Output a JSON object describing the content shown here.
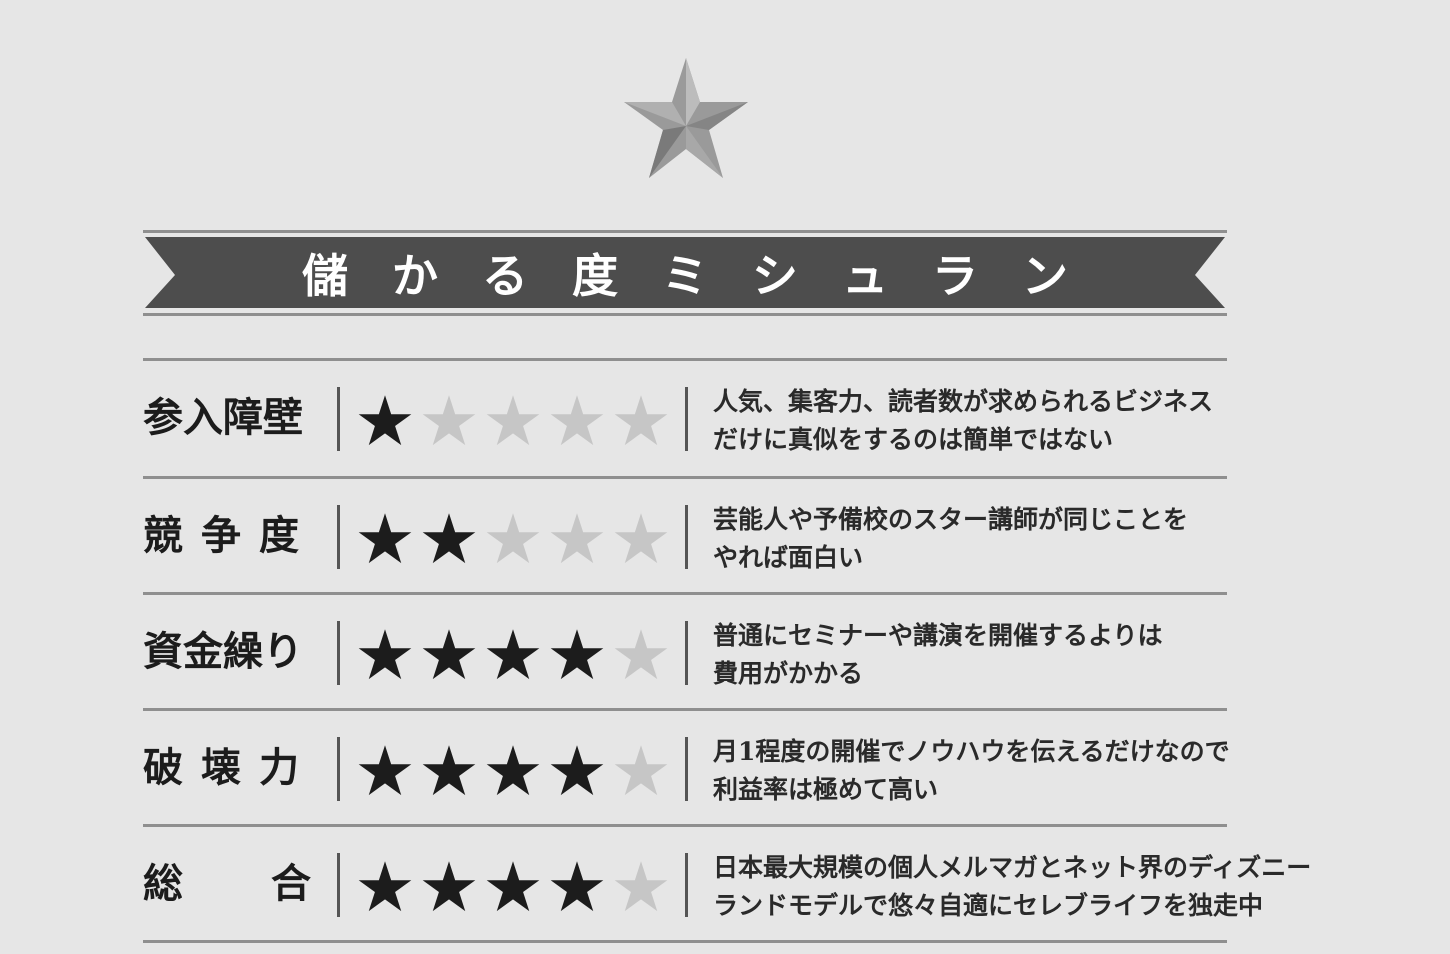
{
  "title": "儲かる度ミシュラン",
  "star_colors": {
    "filled": "#1c1c1c",
    "empty": "#c6c6c6"
  },
  "ratings": [
    {
      "label": "参入障壁",
      "stars": 1,
      "max": 5,
      "desc": [
        "人気、集客力、読者数が求められるビジネス",
        "だけに真似をするのは簡単ではない"
      ]
    },
    {
      "label": "競争度",
      "stars": 2,
      "max": 5,
      "desc": [
        "芸能人や予備校のスター講師が同じことを",
        "やれば面白い"
      ]
    },
    {
      "label": "資金繰り",
      "stars": 4,
      "max": 5,
      "desc": [
        "普通にセミナーや講演を開催するよりは",
        "費用がかかる"
      ]
    },
    {
      "label": "破壊力",
      "stars": 4,
      "max": 5,
      "desc": [
        "月1程度の開催でノウハウを伝えるだけなので",
        "利益率は極めて高い"
      ]
    },
    {
      "label": "総合",
      "stars": 4,
      "max": 5,
      "desc": [
        "日本最大規模の個人メルマガとネット界のディズニー",
        "ランドモデルで悠々自適にセレブライフを独走中"
      ]
    }
  ]
}
